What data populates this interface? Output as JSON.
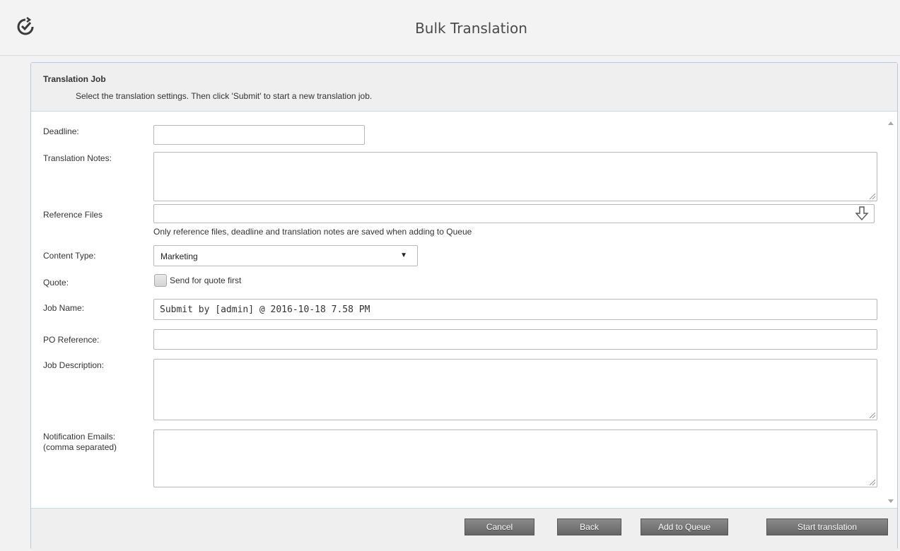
{
  "app": {
    "title": "Bulk Translation",
    "logo_icon": "refresh-check-icon"
  },
  "panel": {
    "title": "Translation Job",
    "subtitle": "Select the translation settings. Then click 'Submit' to start a new translation job."
  },
  "form": {
    "deadline": {
      "label": "Deadline:",
      "value": ""
    },
    "translation_notes": {
      "label": "Translation Notes:",
      "value": ""
    },
    "reference_files": {
      "label": "Reference Files",
      "value": "",
      "hint": "Only reference files, deadline and translation notes are saved when adding to Queue",
      "icon": "upload-arrow-icon"
    },
    "content_type": {
      "label": "Content Type:",
      "value": "Marketing",
      "caret": "▼"
    },
    "quote": {
      "label": "Quote:",
      "checkbox_label": "Send for quote first",
      "checked": false
    },
    "job_name": {
      "label": "Job Name:",
      "value": "Submit by [admin] @ 2016-10-18 7.58 PM"
    },
    "po_reference": {
      "label": "PO Reference:",
      "value": ""
    },
    "job_description": {
      "label": "Job Description:",
      "value": ""
    },
    "notification_emails": {
      "label_line1": "Notification Emails:",
      "label_line2": "(comma separated)",
      "value": ""
    }
  },
  "buttons": {
    "cancel": "Cancel",
    "back": "Back",
    "add_to_queue": "Add to Queue",
    "start_translation": "Start translation"
  },
  "colors": {
    "panel_border": "#b9c9dc",
    "button_bg": "#777777"
  }
}
